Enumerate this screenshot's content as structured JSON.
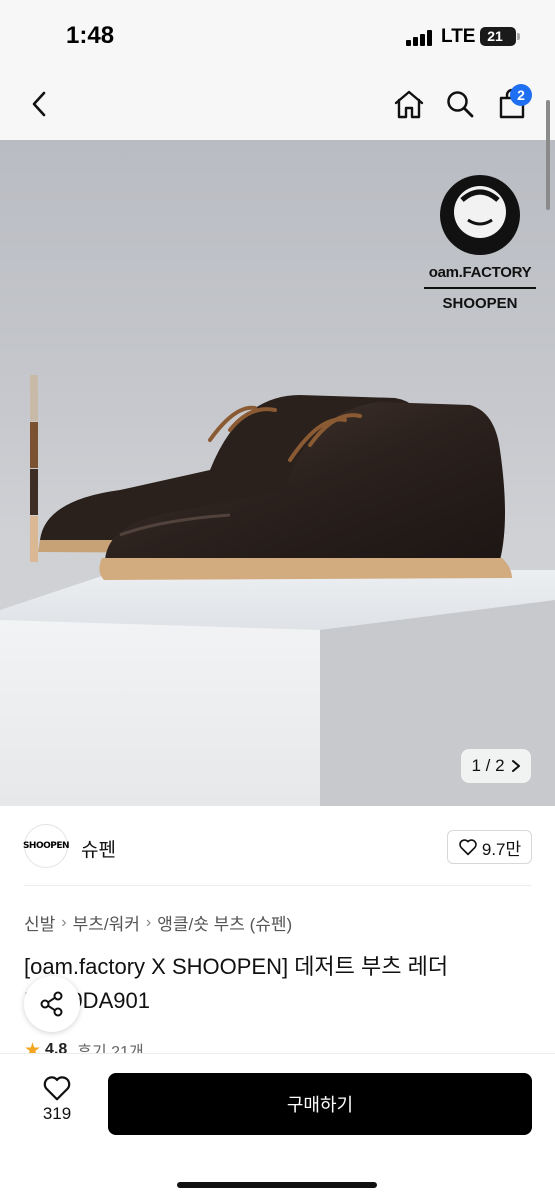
{
  "status_bar": {
    "time": "1:48",
    "network": "LTE",
    "battery": "21"
  },
  "nav": {
    "back_icon": "chevron-left-icon",
    "home_icon": "home-icon",
    "search_icon": "search-icon",
    "cart_icon": "cart-icon",
    "cart_count": "2"
  },
  "hero": {
    "page_indicator": "1 / 2",
    "brand_watermark_line1": "oam.FACTORY",
    "brand_watermark_line2": "SHOOPEN",
    "color_swatches": [
      "#c9b9a8",
      "#7b5231",
      "#3d2d25",
      "#d9b893"
    ]
  },
  "brand": {
    "logo_text": "SHOOPEN",
    "name": "슈펜",
    "like_count": "9.7만"
  },
  "breadcrumb": [
    "신발",
    "부츠/워커",
    "앵클/숏 부츠 (슈펜)"
  ],
  "product": {
    "title": "[oam.factory X SHOOPEN] 데저트 부츠 레더 HM19DA901",
    "rating": "4.8",
    "reviews": "후기 21개"
  },
  "bottom_bar": {
    "wish_count": "319",
    "buy_label": "구매하기"
  }
}
